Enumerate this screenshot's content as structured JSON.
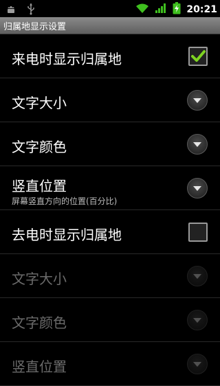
{
  "status": {
    "time": "20:21"
  },
  "title": "归属地显示设置",
  "rows": [
    {
      "label": "来电时显示归属地",
      "control": "checkbox",
      "checked": true,
      "enabled": true
    },
    {
      "label": "文字大小",
      "control": "dropdown",
      "enabled": true
    },
    {
      "label": "文字颜色",
      "control": "dropdown",
      "enabled": true
    },
    {
      "label": "竖直位置",
      "summary": "屏幕竖直方向的位置(百分比)",
      "control": "dropdown",
      "enabled": true
    },
    {
      "label": "去电时显示归属地",
      "control": "checkbox",
      "checked": false,
      "enabled": true
    },
    {
      "label": "文字大小",
      "control": "dropdown",
      "enabled": false
    },
    {
      "label": "文字颜色",
      "control": "dropdown",
      "enabled": false
    },
    {
      "label": "竖直位置",
      "control": "dropdown",
      "enabled": false
    }
  ],
  "colors": {
    "accent_check": "#7ed321",
    "title_bar": "#7a7a7a"
  }
}
